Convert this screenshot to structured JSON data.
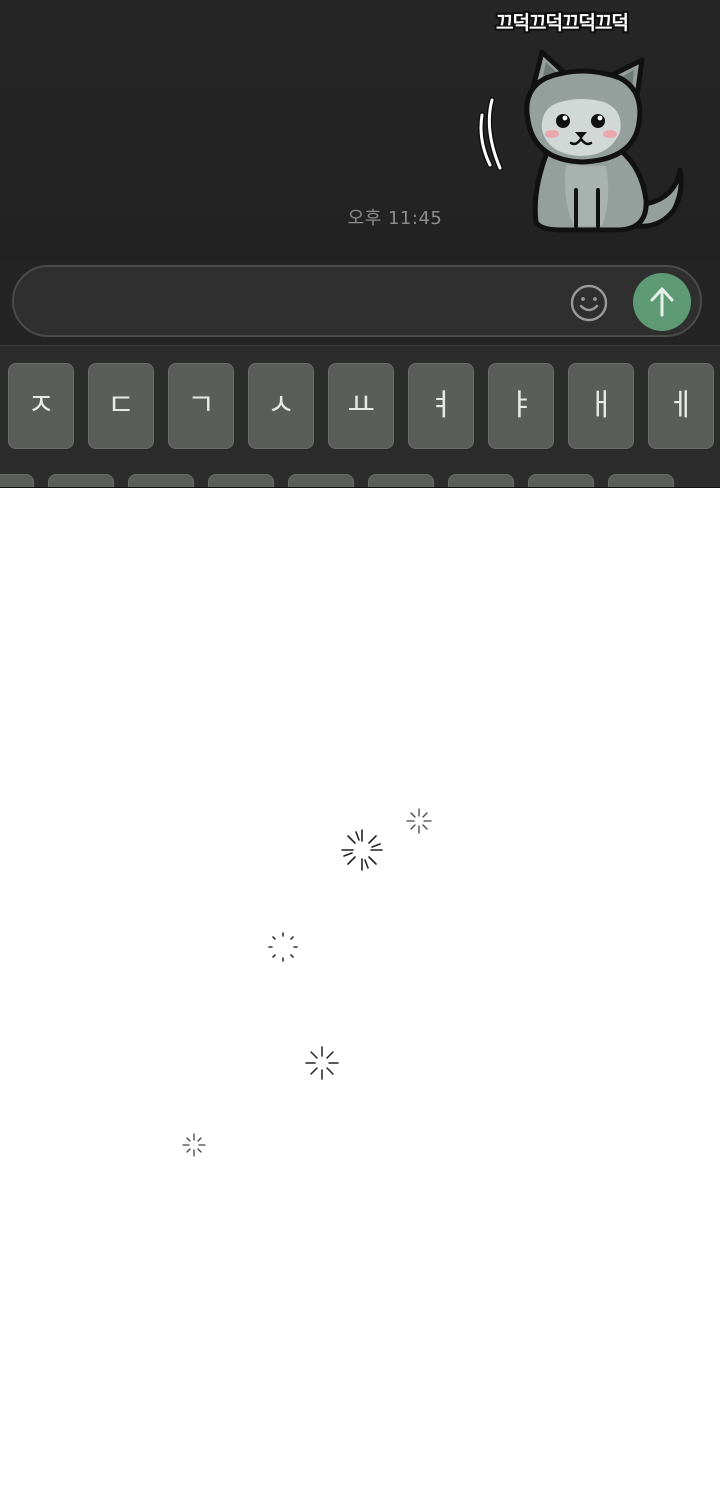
{
  "chat": {
    "timestamp": "오후 11:45",
    "sticker": {
      "caption": "끄덕끄덕끄덕끄덕",
      "character": "gray-wolf-cat-nodding"
    }
  },
  "composer": {
    "message_value": "",
    "placeholder": "",
    "emoji_icon": "smiley-face-icon",
    "send_icon": "arrow-up-icon",
    "send_color": "#5e9a73"
  },
  "keyboard": {
    "row1": [
      "ㅈ",
      "ㄷ",
      "ㄱ",
      "ㅅ",
      "ㅛ",
      "ㅕ",
      "ㅑ",
      "ㅐ",
      "ㅔ"
    ]
  },
  "colors": {
    "background_dark": "#242424",
    "key": "#5b5d5b",
    "accent": "#5e9a73"
  }
}
